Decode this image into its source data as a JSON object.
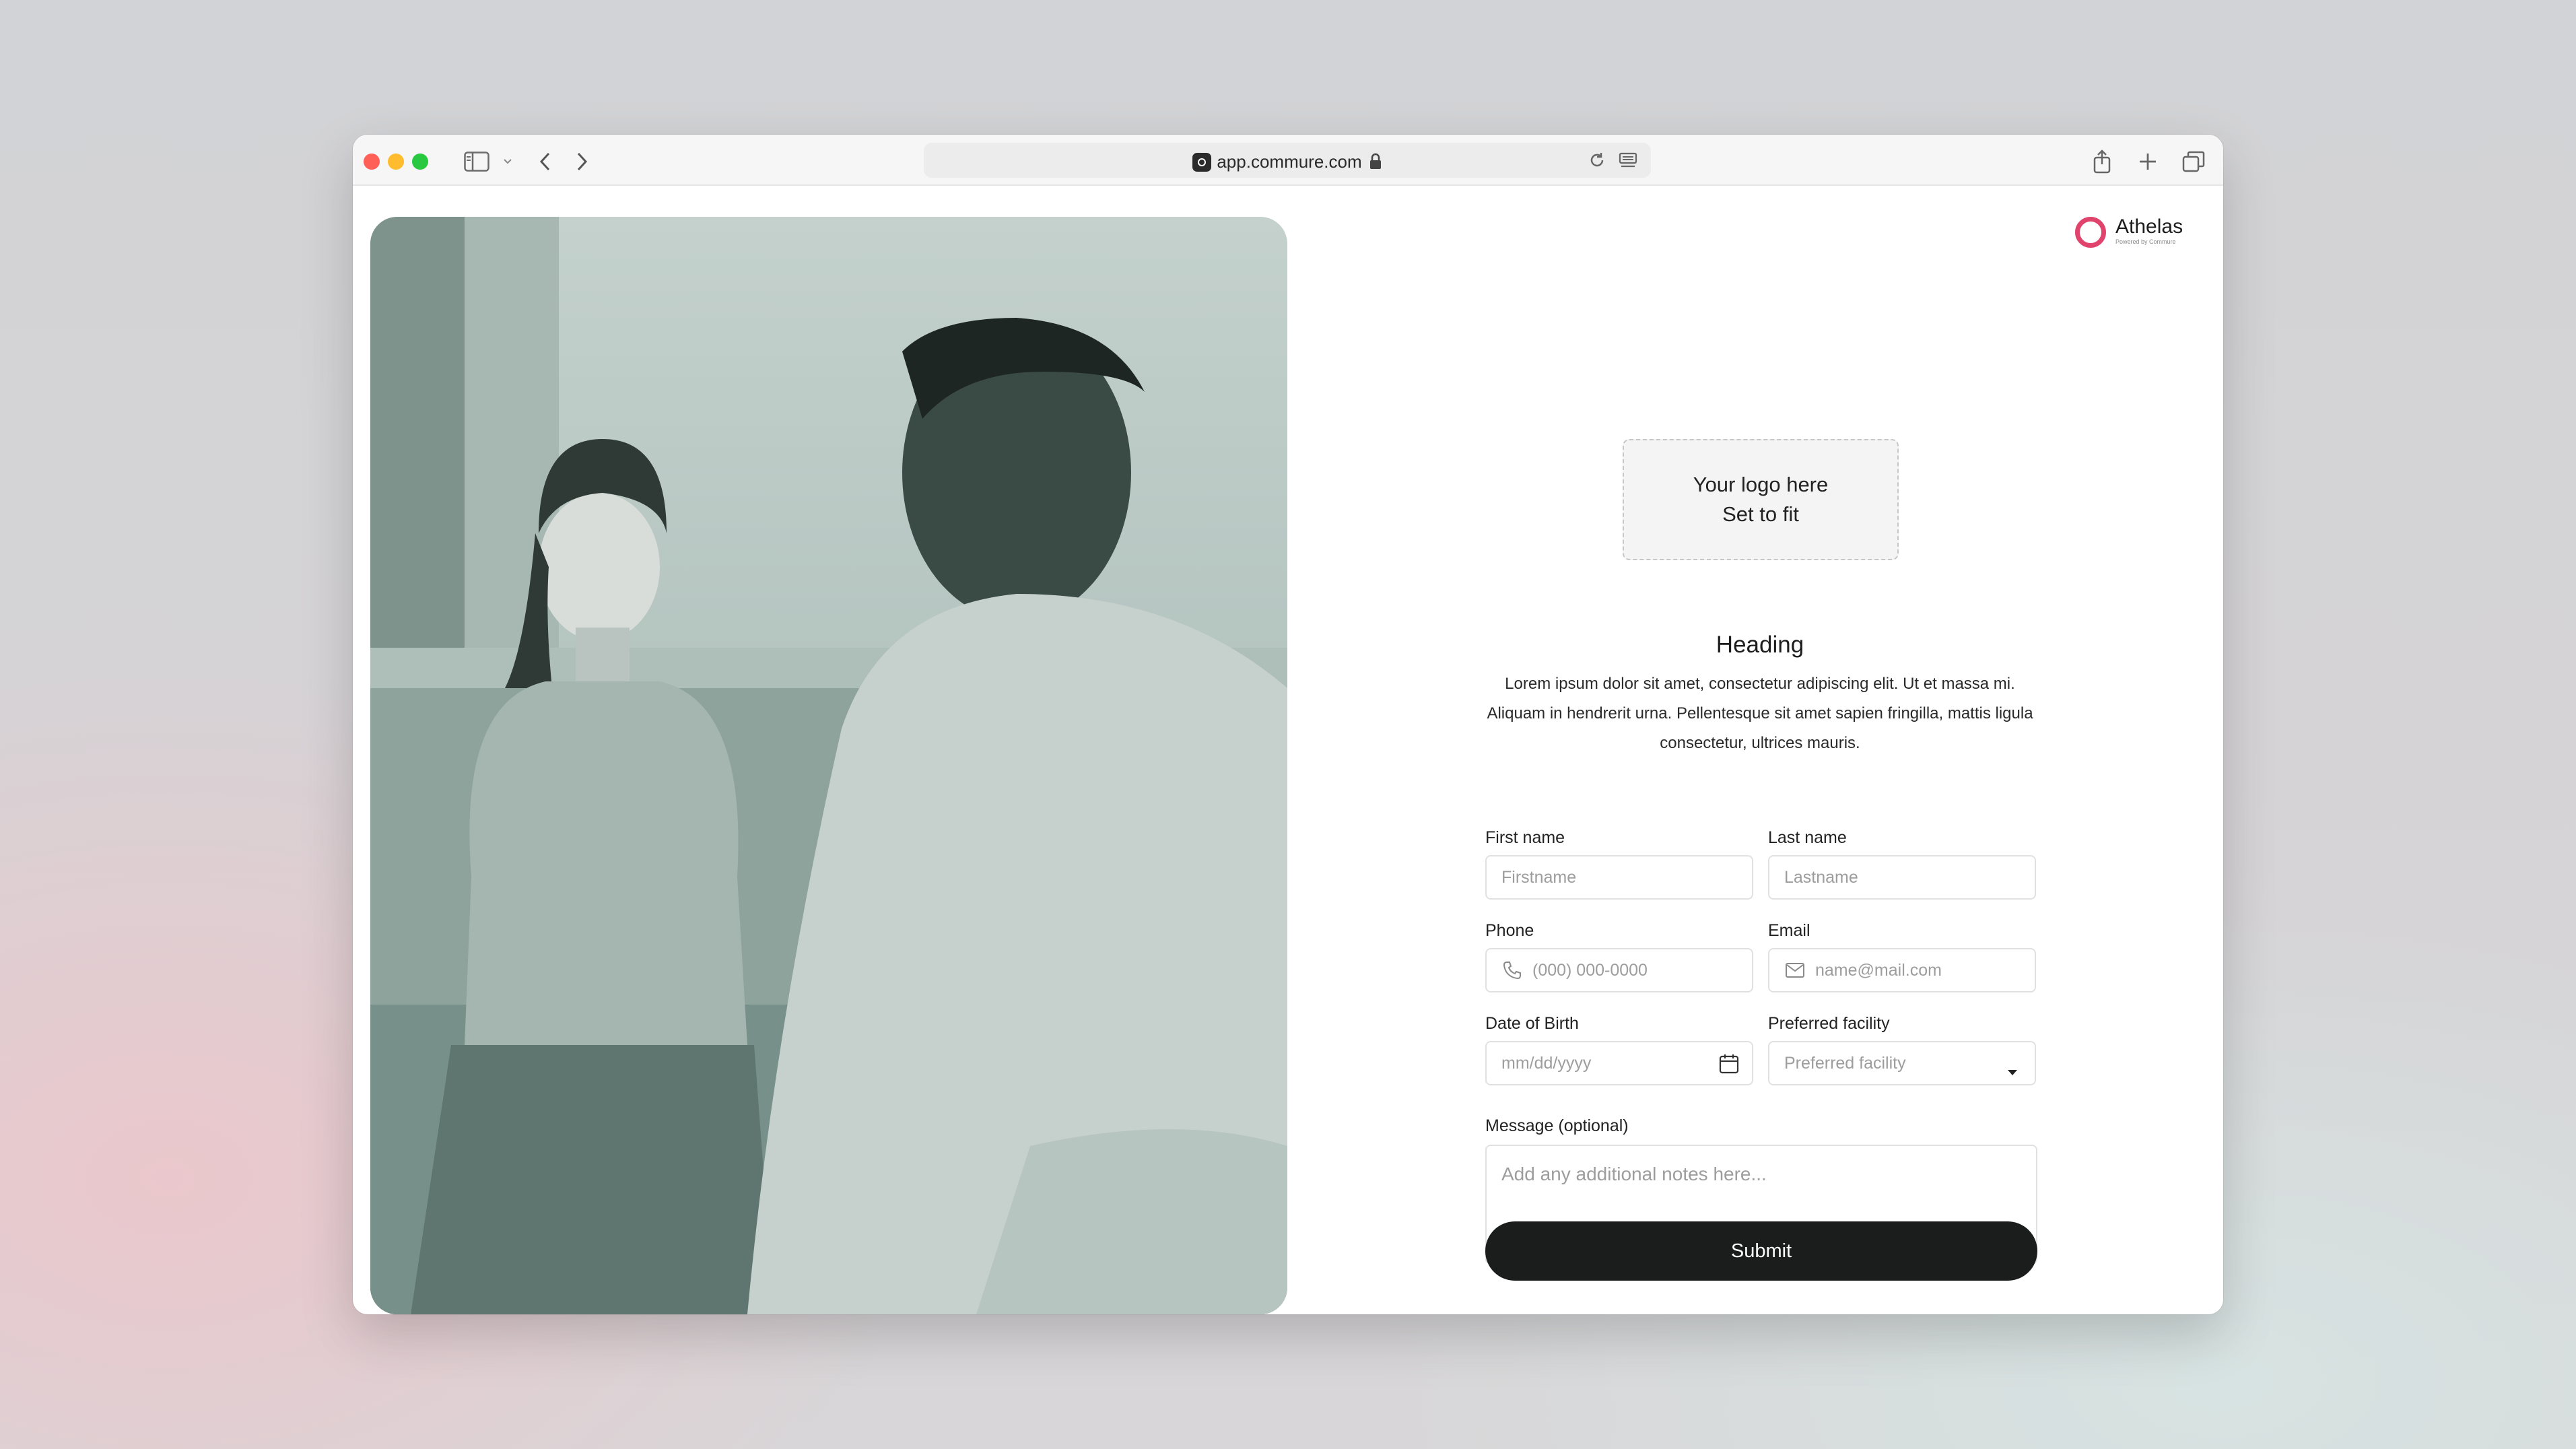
{
  "browser": {
    "url": "app.commure.com"
  },
  "brand": {
    "name": "Athelas",
    "subtitle": "Powered by Commure",
    "accent": "#e0446c"
  },
  "logo_placeholder": {
    "line1": "Your logo here",
    "line2": "Set to fit"
  },
  "intro": {
    "heading": "Heading",
    "body": "Lorem ipsum dolor sit amet, consectetur adipiscing elit. Ut et massa mi. Aliquam in hendrerit urna. Pellentesque sit amet sapien fringilla, mattis ligula consectetur, ultrices mauris."
  },
  "form": {
    "first_name": {
      "label": "First name",
      "placeholder": "Firstname"
    },
    "last_name": {
      "label": "Last name",
      "placeholder": "Lastname"
    },
    "phone": {
      "label": "Phone",
      "placeholder": "(000) 000-0000",
      "icon": "phone-icon"
    },
    "email": {
      "label": "Email",
      "placeholder": "name@mail.com",
      "icon": "mail-icon"
    },
    "dob": {
      "label": "Date of Birth",
      "placeholder": "mm/dd/yyyy",
      "icon": "calendar-icon"
    },
    "facility": {
      "label": "Preferred facility",
      "selected": "Preferred facility",
      "icon": "caret-down-icon"
    },
    "message": {
      "label": "Message (optional)",
      "placeholder": "Add any additional notes here..."
    },
    "submit_label": "Submit",
    "submit_color": "#1b1c1c"
  }
}
